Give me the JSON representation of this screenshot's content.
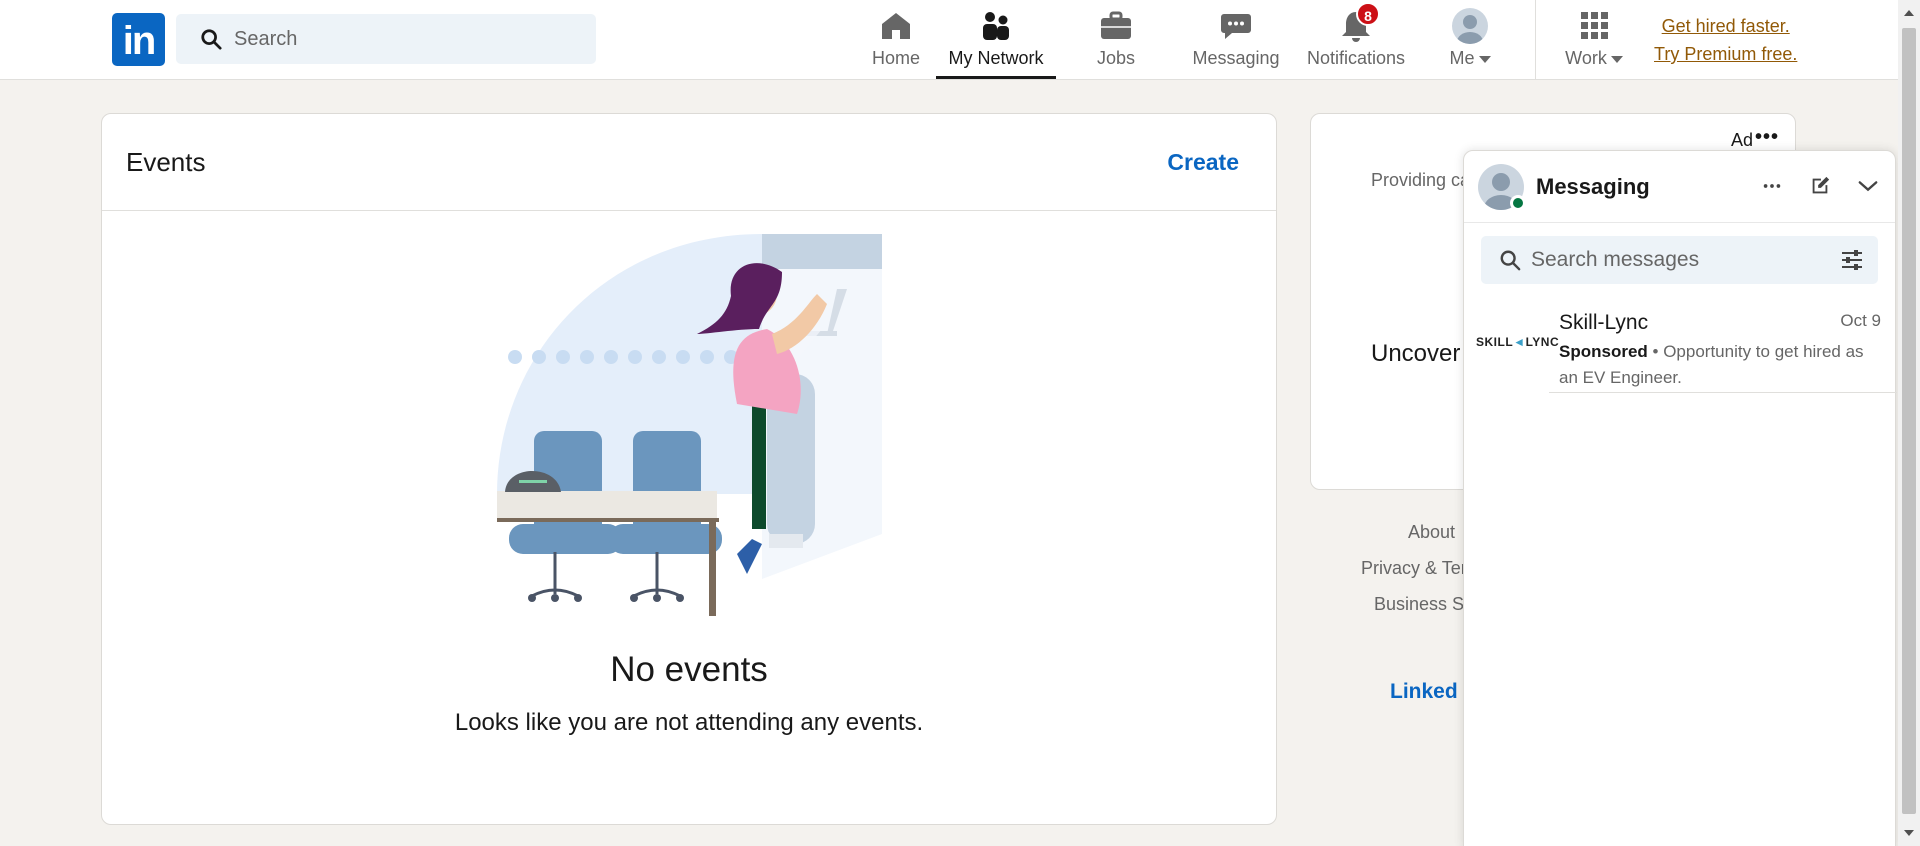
{
  "nav": {
    "logo": "in",
    "search_placeholder": "Search",
    "items": [
      {
        "label": "Home",
        "icon": "home-icon"
      },
      {
        "label": "My Network",
        "icon": "network-icon",
        "active": true
      },
      {
        "label": "Jobs",
        "icon": "briefcase-icon"
      },
      {
        "label": "Messaging",
        "icon": "chat-icon"
      },
      {
        "label": "Notifications",
        "icon": "bell-icon",
        "badge": "8"
      },
      {
        "label": "Me",
        "icon": "avatar"
      },
      {
        "label": "Work",
        "icon": "grid-icon"
      }
    ],
    "premium_line1": "Get hired faster.",
    "premium_line2": "Try Premium free."
  },
  "events": {
    "title": "Events",
    "create_label": "Create",
    "empty_title": "No events",
    "empty_subtitle": "Looks like you are not attending any events."
  },
  "ad": {
    "label": "Ad",
    "more": "•••",
    "text1": "Providing ca",
    "text2": "Uncover A"
  },
  "footer": {
    "about": "About",
    "privacy": "Privacy & Ter",
    "business": "Business Se",
    "brand": "Linked"
  },
  "messaging": {
    "title": "Messaging",
    "search_placeholder": "Search messages",
    "conversation": {
      "logo_text_1": "SKILL",
      "logo_text_2": "LYNC",
      "name": "Skill-Lync",
      "date": "Oct 9",
      "sponsored": "Sponsored",
      "bullet": " • ",
      "preview": "Opportunity to get hired as an EV Engineer."
    }
  },
  "colors": {
    "brand": "#0a66c2",
    "premium": "#915907",
    "badge": "#cc1016",
    "online": "#057642"
  }
}
